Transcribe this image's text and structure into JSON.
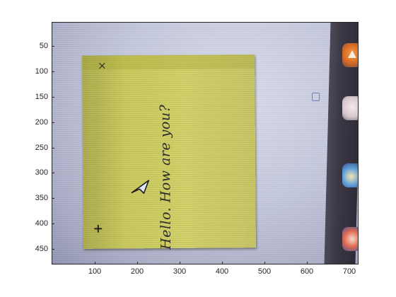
{
  "figure": {
    "y_ticks": [
      "50",
      "100",
      "150",
      "200",
      "250",
      "300",
      "350",
      "400",
      "450"
    ],
    "x_ticks": [
      "100",
      "200",
      "300",
      "400",
      "500",
      "600",
      "700"
    ]
  },
  "photo": {
    "sticky_note": {
      "text": "Hello. How are you?",
      "close_symbol": "×",
      "add_symbol": "+",
      "color": "#c8c85a"
    },
    "desktop": {
      "background_color": "#c4c8dd",
      "taskbar_color": "#3a3744",
      "dock_icons": [
        "orange-app-icon",
        "light-app-icon",
        "blue-app-icon",
        "red-app-icon"
      ]
    }
  }
}
